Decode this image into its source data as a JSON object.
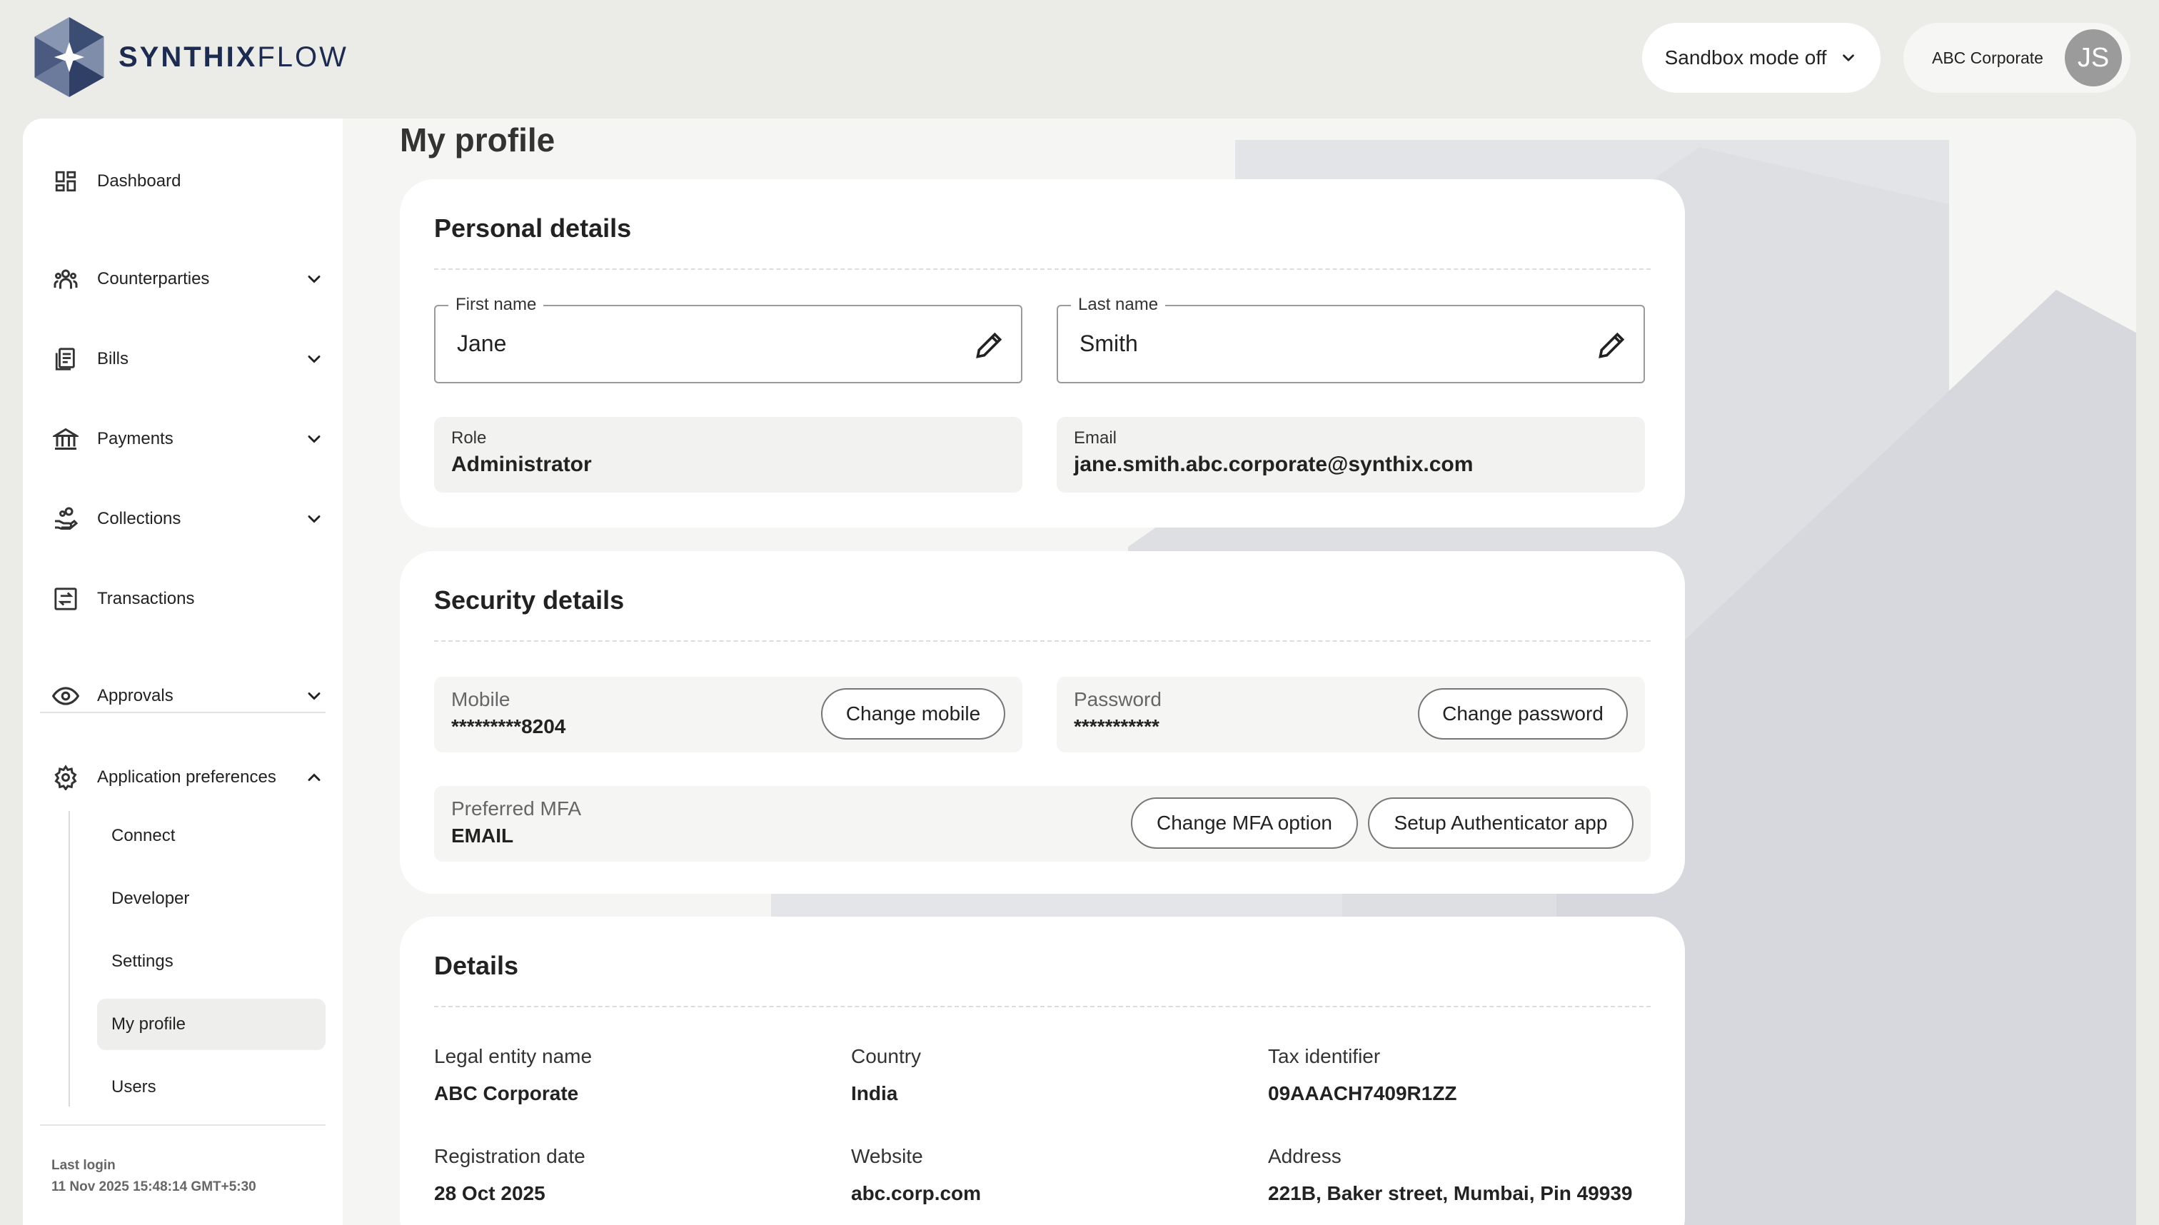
{
  "brand": {
    "name_bold": "SYNTHIX",
    "name_light": "FLOW"
  },
  "header": {
    "sandbox_label": "Sandbox mode off",
    "account_name": "ABC Corporate",
    "avatar_initials": "JS"
  },
  "sidebar": {
    "items": [
      {
        "label": "Dashboard",
        "icon": "dashboard-icon"
      },
      {
        "label": "Counterparties",
        "icon": "people-icon"
      },
      {
        "label": "Bills",
        "icon": "bill-icon"
      },
      {
        "label": "Payments",
        "icon": "bank-icon"
      },
      {
        "label": "Collections",
        "icon": "hand-coins-icon"
      },
      {
        "label": "Transactions",
        "icon": "transfer-icon"
      },
      {
        "label": "Approvals",
        "icon": "eye-icon"
      },
      {
        "label": "Application preferences",
        "icon": "gear-icon"
      }
    ],
    "subitems": [
      "Connect",
      "Developer",
      "Settings",
      "My profile",
      "Users"
    ],
    "active_subitem": "My profile",
    "last_login_label": "Last login",
    "last_login_value": "11 Nov 2025 15:48:14 GMT+5:30"
  },
  "page": {
    "title": "My profile"
  },
  "personal": {
    "heading": "Personal details",
    "first_name_label": "First name",
    "first_name": "Jane",
    "last_name_label": "Last name",
    "last_name": "Smith",
    "role_label": "Role",
    "role": "Administrator",
    "email_label": "Email",
    "email": "jane.smith.abc.corporate@synthix.com"
  },
  "security": {
    "heading": "Security details",
    "mobile_label": "Mobile",
    "mobile_value": "*********8204",
    "change_mobile": "Change mobile",
    "password_label": "Password",
    "password_value": "***********",
    "change_password": "Change password",
    "mfa_label": "Preferred MFA",
    "mfa_value": "EMAIL",
    "change_mfa": "Change MFA option",
    "setup_auth": "Setup Authenticator app"
  },
  "details": {
    "heading": "Details",
    "legal_entity_label": "Legal entity name",
    "legal_entity": "ABC Corporate",
    "country_label": "Country",
    "country": "India",
    "tax_label": "Tax identifier",
    "tax": "09AAACH7409R1ZZ",
    "reg_date_label": "Registration date",
    "reg_date": "28 Oct 2025",
    "website_label": "Website",
    "website": "abc.corp.com",
    "address_label": "Address",
    "address": "221B, Baker street, Mumbai, Pin 49939"
  },
  "colors": {
    "brand": "#1c2b4f",
    "background": "#ebebe8",
    "card": "#ffffff"
  }
}
